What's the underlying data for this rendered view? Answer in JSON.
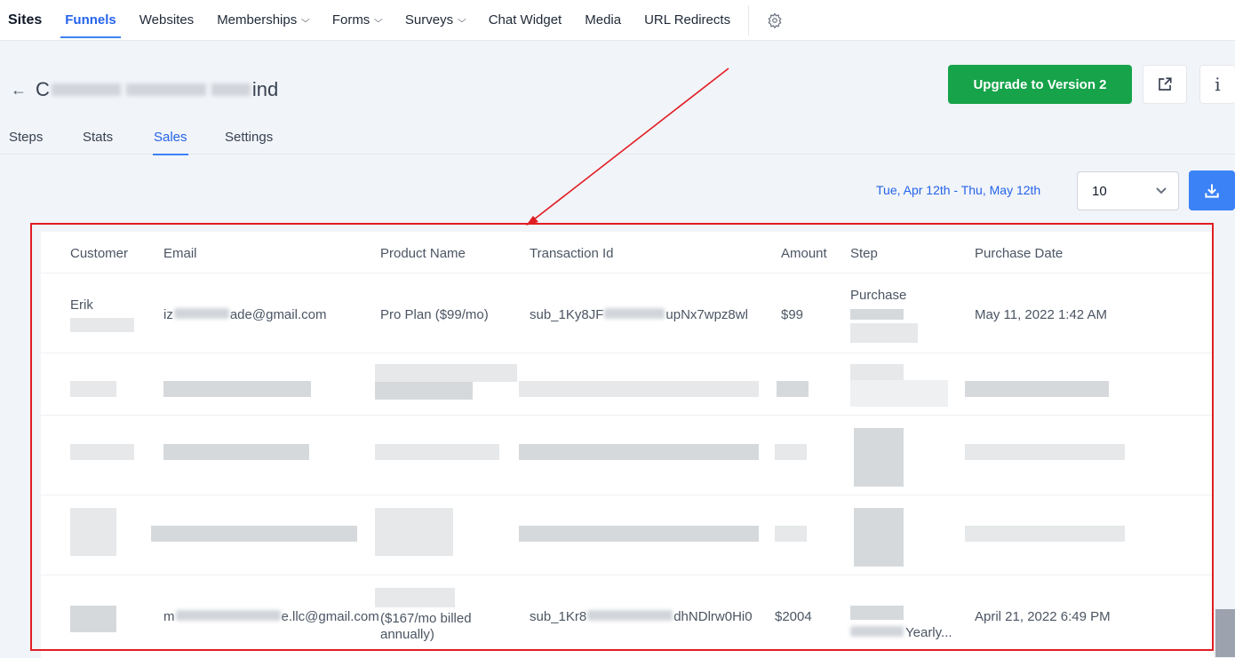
{
  "nav": {
    "brand": "Sites",
    "items": [
      {
        "label": "Funnels",
        "active": true,
        "dropdown": false
      },
      {
        "label": "Websites",
        "active": false,
        "dropdown": false
      },
      {
        "label": "Memberships",
        "active": false,
        "dropdown": true
      },
      {
        "label": "Forms",
        "active": false,
        "dropdown": true
      },
      {
        "label": "Surveys",
        "active": false,
        "dropdown": true
      },
      {
        "label": "Chat Widget",
        "active": false,
        "dropdown": false
      },
      {
        "label": "Media",
        "active": false,
        "dropdown": false
      },
      {
        "label": "URL Redirects",
        "active": false,
        "dropdown": false
      }
    ],
    "settings_icon": "gear-icon"
  },
  "header": {
    "back_icon": "arrow-left-icon",
    "title_start": "C",
    "title_end": "ind",
    "upgrade_label": "Upgrade to Version 2",
    "open_icon": "external-link-icon",
    "info_label": "i"
  },
  "tabs": [
    {
      "label": "Steps",
      "active": false
    },
    {
      "label": "Stats",
      "active": false
    },
    {
      "label": "Sales",
      "active": true
    },
    {
      "label": "Settings",
      "active": false
    }
  ],
  "filters": {
    "date_range": "Tue, Apr 12th - Thu, May 12th",
    "page_size": "10",
    "download_icon": "download-icon"
  },
  "table": {
    "columns": [
      "Customer",
      "Email",
      "Product Name",
      "Transaction Id",
      "Amount",
      "Step",
      "Purchase Date"
    ],
    "rows": [
      {
        "customer": "Erik",
        "email_start": "iz",
        "email_end": "ade@gmail.com",
        "product": "Pro Plan ($99/mo)",
        "txn_start": "sub_1Ky8JF",
        "txn_end": "upNx7wpz8wl",
        "amount": "$99",
        "step": "Purchase",
        "date": "May 11, 2022 1:42 AM"
      },
      {
        "customer": "",
        "email_start": "",
        "email_end": "",
        "product": "",
        "txn_start": "",
        "txn_end": "",
        "amount": "",
        "step": "",
        "date": ""
      },
      {
        "customer": "",
        "email_start": "",
        "email_end": "",
        "product": "",
        "txn_start": "",
        "txn_end": "",
        "amount": "",
        "step": "",
        "date": ""
      },
      {
        "customer": "",
        "email_start": "",
        "email_end": "",
        "product": "",
        "txn_start": "",
        "txn_end": "",
        "amount": "",
        "step": "",
        "date": ""
      },
      {
        "customer": "",
        "email_start": "m",
        "email_end": "e.llc@gmail.com",
        "product_line1": "($167/mo billed",
        "product_line2": "annually)",
        "txn_start": "sub_1Kr8",
        "txn_end": "dhNDlrw0Hi0",
        "amount": "$2004",
        "step_end": "Yearly...",
        "date": "April 21, 2022 6:49 PM"
      }
    ]
  },
  "colors": {
    "accent": "#3b82f6",
    "upgrade": "#16a34a",
    "highlight": "#e11d24"
  }
}
